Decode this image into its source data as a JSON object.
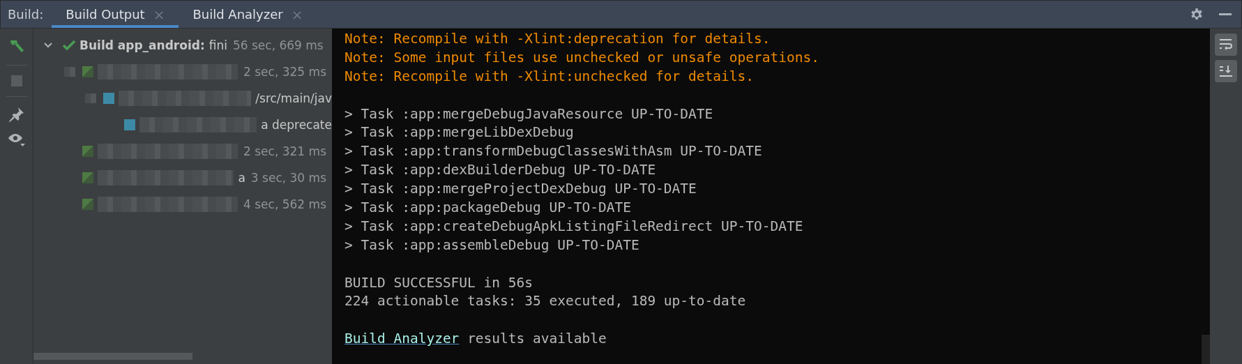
{
  "header": {
    "label": "Build:",
    "tabs": [
      {
        "label": "Build Output",
        "close": "×",
        "selected": true
      },
      {
        "label": "Build Analyzer",
        "close": "×",
        "selected": false
      }
    ]
  },
  "left_toolbar": [
    {
      "kind": "hammer",
      "disabled": false
    },
    {
      "kind": "stop",
      "disabled": true
    },
    {
      "kind": "pin",
      "disabled": false
    },
    {
      "kind": "eye",
      "disabled": false
    }
  ],
  "tree": [
    {
      "kind": "check",
      "bold": "Build app_android:",
      "label": "fini",
      "time": "56 sec, 669 ms",
      "expanded": true,
      "children": [
        {
          "kind": "task",
          "time": "2 sec, 325 ms",
          "children": [
            {
              "kind": "file",
              "label": "/src/main/jav",
              "children": [
                {
                  "kind": "file",
                  "label": "a deprecate"
                }
              ]
            }
          ]
        },
        {
          "kind": "task",
          "time": "2 sec, 321 ms"
        },
        {
          "kind": "task",
          "label": "a",
          "time": "3 sec, 30 ms"
        },
        {
          "kind": "task",
          "time": "4 sec, 562 ms"
        }
      ]
    }
  ],
  "console": [
    {
      "kind": "note",
      "text": "Note: Recompile with -Xlint:deprecation for details."
    },
    {
      "kind": "note",
      "text": "Note: Some input files use unchecked or unsafe operations."
    },
    {
      "kind": "note",
      "text": "Note: Recompile with -Xlint:unchecked for details."
    },
    {
      "kind": "blank"
    },
    {
      "kind": "plain",
      "text": "> Task :app:mergeDebugJavaResource UP-TO-DATE"
    },
    {
      "kind": "plain",
      "text": "> Task :app:mergeLibDexDebug"
    },
    {
      "kind": "plain",
      "text": "> Task :app:transformDebugClassesWithAsm UP-TO-DATE"
    },
    {
      "kind": "plain",
      "text": "> Task :app:dexBuilderDebug UP-TO-DATE"
    },
    {
      "kind": "plain",
      "text": "> Task :app:mergeProjectDexDebug UP-TO-DATE"
    },
    {
      "kind": "plain",
      "text": "> Task :app:packageDebug UP-TO-DATE"
    },
    {
      "kind": "plain",
      "text": "> Task :app:createDebugApkListingFileRedirect UP-TO-DATE"
    },
    {
      "kind": "plain",
      "text": "> Task :app:assembleDebug UP-TO-DATE"
    },
    {
      "kind": "blank"
    },
    {
      "kind": "plain",
      "text": "BUILD SUCCESSFUL in 56s"
    },
    {
      "kind": "plain",
      "text": "224 actionable tasks: 35 executed, 189 up-to-date"
    },
    {
      "kind": "blank"
    },
    {
      "kind": "link",
      "link": "Build Analyzer",
      "text": "results available"
    }
  ],
  "right_toolbar": [
    {
      "kind": "wrap"
    },
    {
      "kind": "scroll_end"
    }
  ]
}
